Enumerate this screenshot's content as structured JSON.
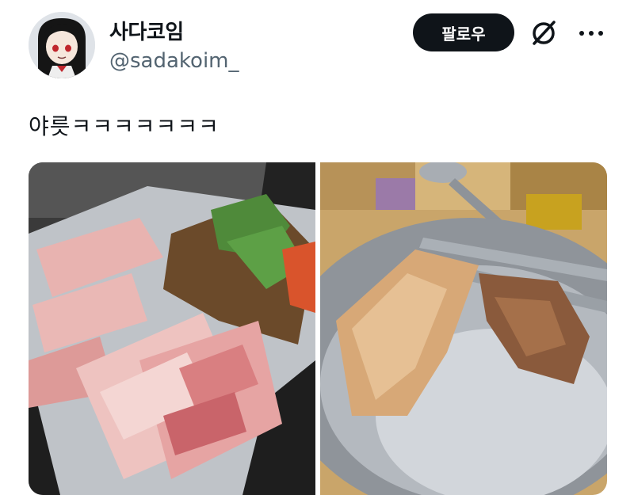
{
  "tweet": {
    "display_name": "사다코임",
    "handle": "@sadakoim_",
    "follow_label": "팔로우",
    "text": "야릇ㅋㅋㅋㅋㅋㅋㅋ"
  },
  "icons": {
    "grok": "grok-icon",
    "more": "more-icon"
  },
  "colors": {
    "text": "#0f1419",
    "secondary": "#536471",
    "follow_bg": "#0f1419"
  },
  "media": {
    "count": 2
  }
}
